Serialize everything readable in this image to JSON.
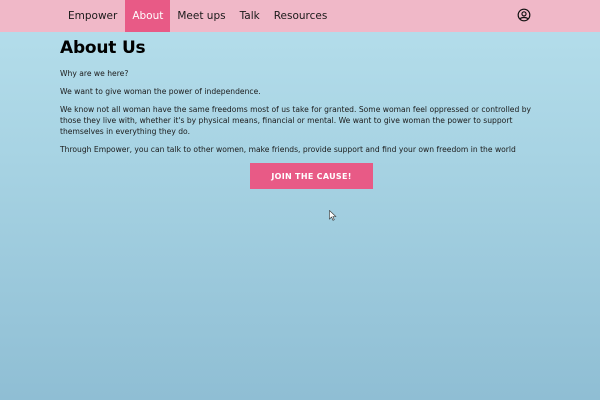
{
  "nav": {
    "brand": "Empower",
    "items": [
      {
        "label": "About",
        "active": true
      },
      {
        "label": "Meet ups",
        "active": false
      },
      {
        "label": "Talk",
        "active": false
      },
      {
        "label": "Resources",
        "active": false
      }
    ],
    "user_icon": "user-circle-icon"
  },
  "main": {
    "title": "About Us",
    "paragraphs": [
      "Why are we here?",
      "We want to give woman the power of independence.",
      "We know not all woman have the same freedoms most of us take for granted. Some woman feel oppressed or controlled by those they live with, whether it's by physical means, financial or mental. We want to give woman the power to support themselves in everything they do.",
      "Through Empower, you can talk to other women, make friends, provide support and find your own freedom in the world"
    ],
    "cta_label": "JOIN THE CAUSE!"
  },
  "colors": {
    "nav_background": "#f0b8c8",
    "accent": "#e85a86",
    "page_gradient_top": "#b6dfec",
    "page_gradient_bottom": "#8fbed4"
  }
}
